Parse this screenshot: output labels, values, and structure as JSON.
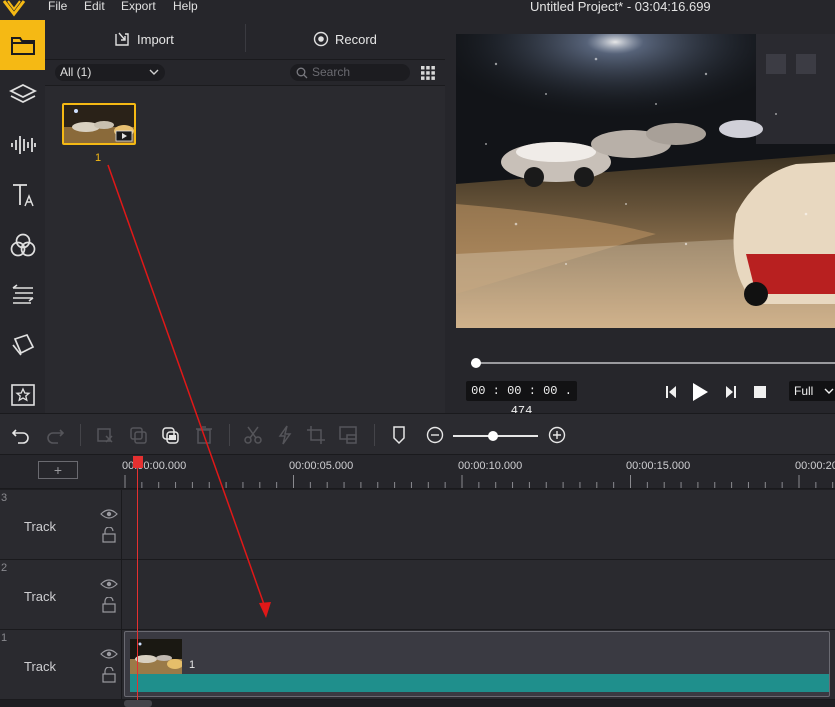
{
  "menu": {
    "file": "File",
    "edit": "Edit",
    "export": "Export",
    "help": "Help"
  },
  "window": {
    "title": "Untitled Project* - 03:04:16.699"
  },
  "sidebar": {
    "items": [
      "folder-icon",
      "layers-icon",
      "audio-wave-icon",
      "text-icon",
      "filters-icon",
      "transitions-icon",
      "overlay-icon",
      "elements-icon"
    ]
  },
  "media": {
    "import_label": "Import",
    "record_label": "Record",
    "filter_value": "All (1)",
    "search_placeholder": "Search",
    "items": [
      {
        "label": "1"
      }
    ]
  },
  "preview": {
    "timecode": "00 : 00 : 00 . 474",
    "quality": "Full",
    "progress": 0.01
  },
  "toolbar": {
    "zoom_level": 0.47
  },
  "timeline": {
    "add_symbol": "+",
    "ruler": [
      "00:00:00.000",
      "00:00:05.000",
      "00:00:10.000",
      "00:00:15.000",
      "00:00:20"
    ],
    "tracks": [
      {
        "num": "3",
        "label": "Track"
      },
      {
        "num": "2",
        "label": "Track"
      },
      {
        "num": "1",
        "label": "Track"
      }
    ],
    "clip": {
      "name": "1"
    }
  },
  "colors": {
    "accent": "#f5b914",
    "playhead": "#e53030",
    "audio": "#1f8f8c"
  }
}
